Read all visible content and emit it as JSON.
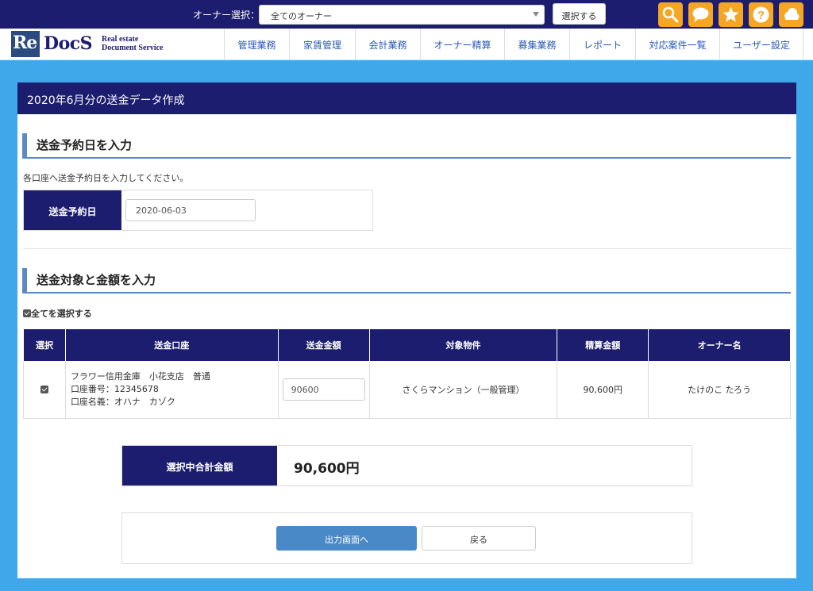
{
  "topbar": {
    "owner_label": "オーナー選択：",
    "owner_select_value": "全てのオーナー",
    "select_button": "選択する",
    "icons": [
      "search-icon",
      "chat-icon",
      "star-icon",
      "help-icon",
      "cloud-icon"
    ]
  },
  "header": {
    "logo_re": "Re",
    "logo_docs": "DocS",
    "logo_sub_line1": "Real estate",
    "logo_sub_line2": "Document Service",
    "nav": [
      "管理業務",
      "家賃管理",
      "会計業務",
      "オーナー精算",
      "募集業務",
      "レポート",
      "対応案件一覧",
      "ユーザー設定"
    ]
  },
  "panel": {
    "title": "2020年6月分の送金データ作成"
  },
  "section1": {
    "title": "送金予約日を入力",
    "hint": "各口座へ送金予約日を入力してください。",
    "date_label": "送金予約日",
    "date_value": "2020-06-03"
  },
  "section2": {
    "title": "送金対象と金額を入力",
    "select_all": "全てを選択する",
    "table": {
      "headers": [
        "選択",
        "送金口座",
        "送金金額",
        "対象物件",
        "精算金額",
        "オーナー名"
      ],
      "rows": [
        {
          "checked": true,
          "account_line1": "フラワー信用金庫　小花支店　普通",
          "account_line2": "口座番号：12345678",
          "account_line3": "口座名義：オハナ　カゾク",
          "amount": "90600",
          "property": "さくらマンション（一般管理）",
          "settlement": "90,600円",
          "owner": "たけのこ たろう"
        }
      ]
    }
  },
  "total": {
    "label": "選択中合計金額",
    "value": "90,600円"
  },
  "actions": {
    "output_button": "出力画面へ",
    "back_button": "戻る"
  },
  "colors": {
    "navy": "#1c1d6e",
    "background": "#3ea8ea",
    "accent_orange": "#f5a623",
    "section_bar": "#5b8ac4",
    "primary_button": "#4a89c8"
  }
}
